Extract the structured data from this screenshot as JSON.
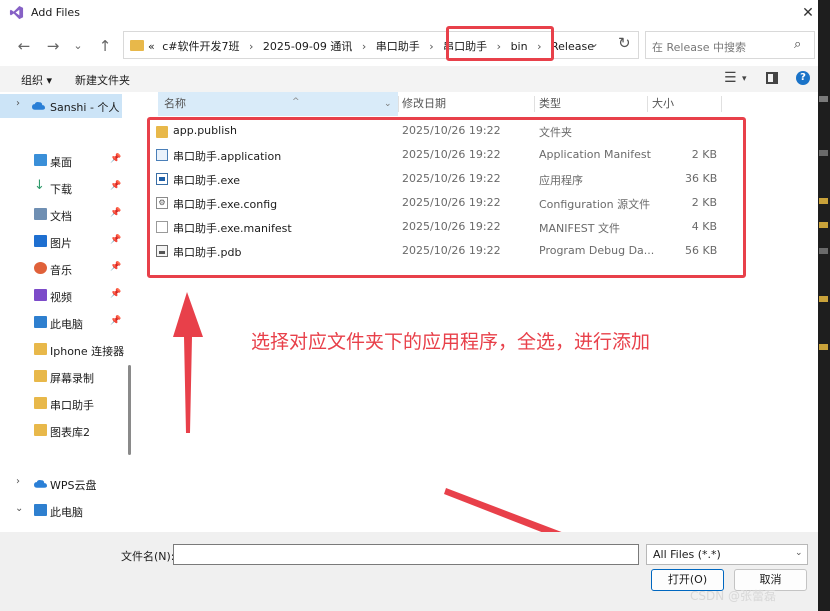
{
  "window": {
    "title": "Add Files",
    "close": "✕"
  },
  "nav": {
    "back": "←",
    "forward": "→",
    "dropdown": "⌄",
    "up": "↑"
  },
  "address": {
    "lead": "«",
    "crumbs": [
      "c#软件开发7班",
      "2025-09-09 通讯",
      "串口助手",
      "串口助手",
      "bin",
      "Release"
    ],
    "separator": "›",
    "dropdown": "⌄",
    "refresh": "↻"
  },
  "search": {
    "placeholder": "在 Release 中搜索"
  },
  "toolbar": {
    "organize": "组织 ▾",
    "new_folder": "新建文件夹"
  },
  "sidebar": {
    "top": {
      "label": "Sanshi - 个人"
    },
    "quick": [
      {
        "label": "桌面",
        "icon": "desktop-icon",
        "pinned": true
      },
      {
        "label": "下载",
        "icon": "download-icon",
        "pinned": true
      },
      {
        "label": "文档",
        "icon": "documents-icon",
        "pinned": true
      },
      {
        "label": "图片",
        "icon": "pictures-icon",
        "pinned": true
      },
      {
        "label": "音乐",
        "icon": "music-icon",
        "pinned": true
      },
      {
        "label": "视频",
        "icon": "videos-icon",
        "pinned": true
      },
      {
        "label": "此电脑",
        "icon": "this-pc-icon",
        "pinned": true
      },
      {
        "label": "Iphone 连接器",
        "icon": "folder-icon",
        "pinned": false
      },
      {
        "label": "屏幕录制",
        "icon": "folder-icon",
        "pinned": false
      },
      {
        "label": "串口助手",
        "icon": "folder-icon",
        "pinned": false
      },
      {
        "label": "图表库2",
        "icon": "folder-icon",
        "pinned": false
      }
    ],
    "bottom": [
      {
        "label": "WPS云盘",
        "icon": "cloud-icon"
      },
      {
        "label": "此电脑",
        "icon": "this-pc-icon"
      }
    ],
    "pin_glyph": "📌"
  },
  "columns": {
    "name": "名称",
    "modified": "修改日期",
    "type": "类型",
    "size": "大小"
  },
  "files": [
    {
      "name": "app.publish",
      "modified": "2025/10/26 19:22",
      "type": "文件夹",
      "size": "",
      "icon": "folder-icon"
    },
    {
      "name": "串口助手.application",
      "modified": "2025/10/26 19:22",
      "type": "Application Manifest",
      "size": "2 KB",
      "icon": "application-manifest-icon"
    },
    {
      "name": "串口助手.exe",
      "modified": "2025/10/26 19:22",
      "type": "应用程序",
      "size": "36 KB",
      "icon": "exe-icon"
    },
    {
      "name": "串口助手.exe.config",
      "modified": "2025/10/26 19:22",
      "type": "Configuration 源文件",
      "size": "2 KB",
      "icon": "config-file-icon"
    },
    {
      "name": "串口助手.exe.manifest",
      "modified": "2025/10/26 19:22",
      "type": "MANIFEST 文件",
      "size": "4 KB",
      "icon": "blank-file-icon"
    },
    {
      "name": "串口助手.pdb",
      "modified": "2025/10/26 19:22",
      "type": "Program Debug Da...",
      "size": "56 KB",
      "icon": "pdb-file-icon"
    }
  ],
  "annotation": {
    "text": "选择对应文件夹下的应用程序，全选，进行添加",
    "color": "#e8404a"
  },
  "footer": {
    "filename_label": "文件名(N):",
    "filename_value": "",
    "filter": "All Files (*.*)",
    "open": "打开(O)",
    "cancel": "取消"
  },
  "watermark": "CSDN @张蕾磊",
  "colors": {
    "accent": "#0067c0",
    "highlight": "#e8404a",
    "selected": "#cce4f7"
  }
}
